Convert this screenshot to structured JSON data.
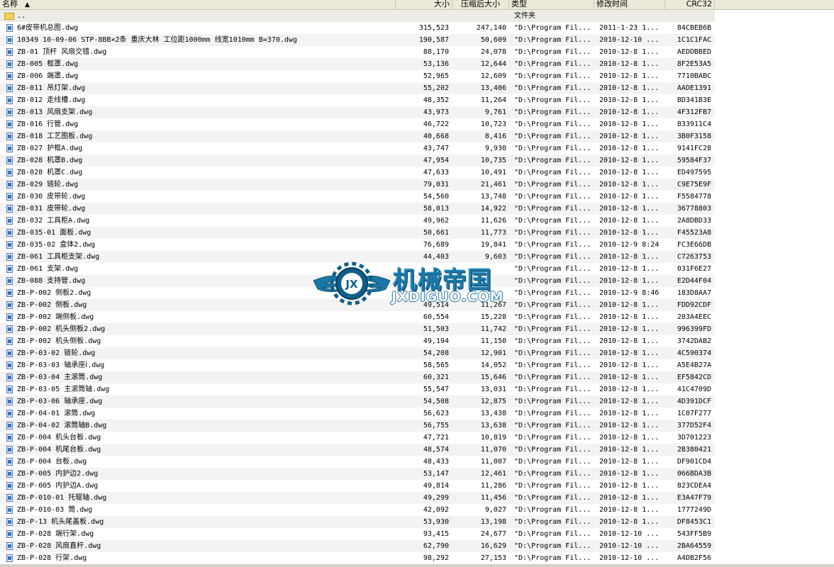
{
  "columns": {
    "name": "名称",
    "size": "大小",
    "packed": "压缩后大小",
    "type": "类型",
    "modified": "修改时间",
    "crc": "CRC32"
  },
  "up_row": {
    "name": "..",
    "type": "文件夹"
  },
  "watermark": {
    "cn": "机械帝国",
    "en": "JXDIGUO.COM"
  },
  "rows": [
    {
      "name": "6#皮带机总图.dwg",
      "size": "315,523",
      "packed": "247,140",
      "type": "\"D:\\Program Fil...",
      "date": "2011-1-23 1...",
      "crc": "84CBEB6B"
    },
    {
      "name": "10349 10-09-06 STP-8BB×2条 重庆大林 工位距1000mm 线宽1010mm B=370.dwg",
      "size": "190,587",
      "packed": "50,609",
      "type": "\"D:\\Program Fil...",
      "date": "2010-12-10 ...",
      "crc": "1C1C1FAC"
    },
    {
      "name": "ZB-01 顶杆 风扇交错.dwg",
      "size": "88,170",
      "packed": "24,078",
      "type": "\"D:\\Program Fil...",
      "date": "2010-12-8 1...",
      "crc": "AEDDBBED"
    },
    {
      "name": "ZB-005 框罩.dwg",
      "size": "53,136",
      "packed": "12,644",
      "type": "\"D:\\Program Fil...",
      "date": "2010-12-8 1...",
      "crc": "8F2E53A5"
    },
    {
      "name": "ZB-006 端罩.dwg",
      "size": "52,965",
      "packed": "12,609",
      "type": "\"D:\\Program Fil...",
      "date": "2010-12-8 1...",
      "crc": "7710BABC"
    },
    {
      "name": "ZB-011 吊灯架.dwg",
      "size": "55,202",
      "packed": "13,406",
      "type": "\"D:\\Program Fil...",
      "date": "2010-12-8 1...",
      "crc": "AADE1391"
    },
    {
      "name": "ZB-012 走线槽.dwg",
      "size": "48,352",
      "packed": "11,264",
      "type": "\"D:\\Program Fil...",
      "date": "2010-12-8 1...",
      "crc": "BD341B3E"
    },
    {
      "name": "ZB-013 风扇支架.dwg",
      "size": "43,973",
      "packed": "9,761",
      "type": "\"D:\\Program Fil...",
      "date": "2010-12-8 1...",
      "crc": "4F312FB7"
    },
    {
      "name": "ZB-016 行管.dwg",
      "size": "46,722",
      "packed": "10,723",
      "type": "\"D:\\Program Fil...",
      "date": "2010-12-8 1...",
      "crc": "833911C4"
    },
    {
      "name": "ZB-018 工艺图板.dwg",
      "size": "40,668",
      "packed": "8,416",
      "type": "\"D:\\Program Fil...",
      "date": "2010-12-8 1...",
      "crc": "3B0F3158"
    },
    {
      "name": "ZB-027 护框A.dwg",
      "size": "43,747",
      "packed": "9,930",
      "type": "\"D:\\Program Fil...",
      "date": "2010-12-8 1...",
      "crc": "9141FC28"
    },
    {
      "name": "ZB-028 机罩B.dwg",
      "size": "47,954",
      "packed": "10,735",
      "type": "\"D:\\Program Fil...",
      "date": "2010-12-8 1...",
      "crc": "59584F37"
    },
    {
      "name": "ZB-028 机罩C.dwg",
      "size": "47,633",
      "packed": "10,491",
      "type": "\"D:\\Program Fil...",
      "date": "2010-12-8 1...",
      "crc": "ED497595"
    },
    {
      "name": "ZB-029 链轮.dwg",
      "size": "79,031",
      "packed": "21,461",
      "type": "\"D:\\Program Fil...",
      "date": "2010-12-8 1...",
      "crc": "C9E75E9F"
    },
    {
      "name": "ZB-030 皮带轮.dwg",
      "size": "54,560",
      "packed": "13,748",
      "type": "\"D:\\Program Fil...",
      "date": "2010-12-8 1...",
      "crc": "F5584778"
    },
    {
      "name": "ZB-031 皮带轮.dwg",
      "size": "58,013",
      "packed": "14,922",
      "type": "\"D:\\Program Fil...",
      "date": "2010-12-8 1...",
      "crc": "36778803"
    },
    {
      "name": "ZB-032 工具柜A.dwg",
      "size": "49,962",
      "packed": "11,626",
      "type": "\"D:\\Program Fil...",
      "date": "2010-12-8 1...",
      "crc": "2A8DBD33"
    },
    {
      "name": "ZB-035-01 面板.dwg",
      "size": "50,661",
      "packed": "11,773",
      "type": "\"D:\\Program Fil...",
      "date": "2010-12-8 1...",
      "crc": "F45523A8"
    },
    {
      "name": "ZB-035-02 盒体2.dwg",
      "size": "76,689",
      "packed": "19,841",
      "type": "\"D:\\Program Fil...",
      "date": "2010-12-9 8:24",
      "crc": "FC3E66DB"
    },
    {
      "name": "ZB-061 工具柜支架.dwg",
      "size": "44,403",
      "packed": "9,603",
      "type": "\"D:\\Program Fil...",
      "date": "2010-12-8 1...",
      "crc": "C7263753"
    },
    {
      "name": "ZB-061 支架.dwg",
      "size": "",
      "packed": "",
      "type": "\"D:\\Program Fil...",
      "date": "2010-12-8 1...",
      "crc": "031F6E27"
    },
    {
      "name": "ZB-088 支持管.dwg",
      "size": "",
      "packed": "",
      "type": "\"D:\\Program Fil...",
      "date": "2010-12-8 1...",
      "crc": "E2D44F04"
    },
    {
      "name": "ZB-P-002 侧板2.dwg",
      "size": "",
      "packed": "",
      "type": "\"D:\\Program Fil...",
      "date": "2010-12-9 8:46",
      "crc": "183D8AA7"
    },
    {
      "name": "ZB-P-002 侧板.dwg",
      "size": "49,514",
      "packed": "11,267",
      "type": "\"D:\\Program Fil...",
      "date": "2010-12-8 1...",
      "crc": "FDD92CDF"
    },
    {
      "name": "ZB-P-002 端侧板.dwg",
      "size": "60,554",
      "packed": "15,228",
      "type": "\"D:\\Program Fil...",
      "date": "2010-12-8 1...",
      "crc": "203A4EEC"
    },
    {
      "name": "ZB-P-002 机头侧板2.dwg",
      "size": "51,503",
      "packed": "11,742",
      "type": "\"D:\\Program Fil...",
      "date": "2010-12-8 1...",
      "crc": "996399FD"
    },
    {
      "name": "ZB-P-002 机头侧板.dwg",
      "size": "49,194",
      "packed": "11,150",
      "type": "\"D:\\Program Fil...",
      "date": "2010-12-8 1...",
      "crc": "3742DAB2"
    },
    {
      "name": "ZB-P-03-02 链轮.dwg",
      "size": "54,208",
      "packed": "12,901",
      "type": "\"D:\\Program Fil...",
      "date": "2010-12-8 1...",
      "crc": "4C590374"
    },
    {
      "name": "ZB-P-03-03 轴承座Ⅰ.dwg",
      "size": "58,565",
      "packed": "14,052",
      "type": "\"D:\\Program Fil...",
      "date": "2010-12-8 1...",
      "crc": "A5E4B27A"
    },
    {
      "name": "ZB-P-03-04 主滚筒.dwg",
      "size": "60,321",
      "packed": "15,646",
      "type": "\"D:\\Program Fil...",
      "date": "2010-12-8 1...",
      "crc": "EF5842CD"
    },
    {
      "name": "ZB-P-03-05 主滚筒轴.dwg",
      "size": "55,547",
      "packed": "13,031",
      "type": "\"D:\\Program Fil...",
      "date": "2010-12-8 1...",
      "crc": "41C4709D"
    },
    {
      "name": "ZB-P-03-06 轴承座.dwg",
      "size": "54,508",
      "packed": "12,875",
      "type": "\"D:\\Program Fil...",
      "date": "2010-12-8 1...",
      "crc": "4D391DCF"
    },
    {
      "name": "ZB-P-04-01 滚筒.dwg",
      "size": "56,623",
      "packed": "13,438",
      "type": "\"D:\\Program Fil...",
      "date": "2010-12-8 1...",
      "crc": "1C07F277"
    },
    {
      "name": "ZB-P-04-02 滚筒轴B.dwg",
      "size": "56,755",
      "packed": "13,638",
      "type": "\"D:\\Program Fil...",
      "date": "2010-12-8 1...",
      "crc": "377D52F4"
    },
    {
      "name": "ZB-P-004 机头台板.dwg",
      "size": "47,721",
      "packed": "10,819",
      "type": "\"D:\\Program Fil...",
      "date": "2010-12-8 1...",
      "crc": "3D701223"
    },
    {
      "name": "ZB-P-004 机尾台板.dwg",
      "size": "48,574",
      "packed": "11,070",
      "type": "\"D:\\Program Fil...",
      "date": "2010-12-8 1...",
      "crc": "2B380421"
    },
    {
      "name": "ZB-P-004 台板.dwg",
      "size": "48,433",
      "packed": "11,007",
      "type": "\"D:\\Program Fil...",
      "date": "2010-12-8 1...",
      "crc": "DF901CD4"
    },
    {
      "name": "ZB-P-005 内护边2.dwg",
      "size": "53,147",
      "packed": "12,461",
      "type": "\"D:\\Program Fil...",
      "date": "2010-12-8 1...",
      "crc": "066BDA3B"
    },
    {
      "name": "ZB-P-005 内护边A.dwg",
      "size": "49,814",
      "packed": "11,286",
      "type": "\"D:\\Program Fil...",
      "date": "2010-12-8 1...",
      "crc": "823CDEA4"
    },
    {
      "name": "ZB-P-010-01 托辊轴.dwg",
      "size": "49,299",
      "packed": "11,456",
      "type": "\"D:\\Program Fil...",
      "date": "2010-12-8 1...",
      "crc": "E3A47F79"
    },
    {
      "name": "ZB-P-010-03 筒.dwg",
      "size": "42,092",
      "packed": "9,027",
      "type": "\"D:\\Program Fil...",
      "date": "2010-12-8 1...",
      "crc": "1777249D"
    },
    {
      "name": "ZB-P-13 机头尾盖板.dwg",
      "size": "53,930",
      "packed": "13,198",
      "type": "\"D:\\Program Fil...",
      "date": "2010-12-8 1...",
      "crc": "DF8453C1"
    },
    {
      "name": "ZB-P-028 端行架.dwg",
      "size": "93,415",
      "packed": "24,677",
      "type": "\"D:\\Program Fil...",
      "date": "2010-12-10 ...",
      "crc": "543FF5B9"
    },
    {
      "name": "ZB-P-028 风扇直杆.dwg",
      "size": "62,790",
      "packed": "16,629",
      "type": "\"D:\\Program Fil...",
      "date": "2010-12-10 ...",
      "crc": "2BA64559"
    },
    {
      "name": "ZB-P-028 行架.dwg",
      "size": "98,292",
      "packed": "27,153",
      "type": "\"D:\\Program Fil...",
      "date": "2010-12-10 ...",
      "crc": "A4DB2F56"
    }
  ]
}
